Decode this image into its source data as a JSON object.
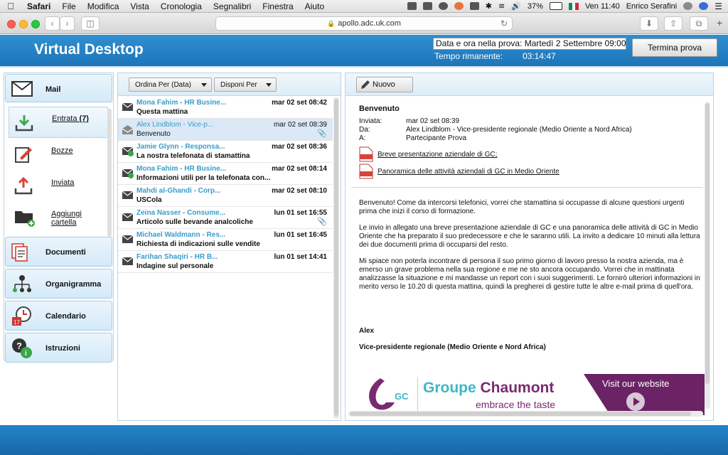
{
  "menubar": {
    "app": "Safari",
    "items": [
      "File",
      "Modifica",
      "Vista",
      "Cronologia",
      "Segnalibri",
      "Finestra",
      "Aiuto"
    ],
    "battery": "37%",
    "clock": "Ven 11:40",
    "user": "Enrico Serafini"
  },
  "browser": {
    "url": "apollo.adc.uk.com"
  },
  "header": {
    "title": "Virtual Desktop",
    "datetime": "Data e ora nella prova: Martedì 2 Settembre 09:00",
    "time_left_label": "Tempo rimanente:",
    "time_left_value": "03:14:47",
    "end_button": "Termina prova"
  },
  "nav": {
    "mail": "Mail",
    "sub": {
      "inbox": "Entrata",
      "inbox_count": "(7)",
      "drafts": "Bozze",
      "sent": "Inviata",
      "add_folder": "Aggiungi cartella"
    },
    "documents": "Documenti",
    "org": "Organigramma",
    "calendar": "Calendario",
    "instructions": "Istruzioni"
  },
  "list": {
    "sort_label": "Ordina Per (Data)",
    "arrange_label": "Disponi Per",
    "messages": [
      {
        "from": "Mona Fahim - HR Busine...",
        "date": "mar 02 set 08:42",
        "subject": "Questa mattina"
      },
      {
        "from": "Alex Lindblom - Vice-p...",
        "date": "mar 02 set 08:39",
        "subject": "Benvenuto"
      },
      {
        "from": "Jamie Glynn - Responsa...",
        "date": "mar 02 set 08:36",
        "subject": "La nostra telefonata di stamattina"
      },
      {
        "from": "Mona Fahim - HR Busine...",
        "date": "mar 02 set 08:14",
        "subject": "Informazioni utili per la telefonata con..."
      },
      {
        "from": "Mahdi al-Ghandi - Corp...",
        "date": "mar 02 set 08:10",
        "subject": "USCola"
      },
      {
        "from": "Zeina Nasser - Consume...",
        "date": "lun 01 set 16:55",
        "subject": "Articolo sulle bevande analcoliche"
      },
      {
        "from": "Michael Waldmann - Res...",
        "date": "lun 01 set 16:45",
        "subject": "Richiesta di indicazioni sulle vendite"
      },
      {
        "from": "Farihan Shaqiri - HR B...",
        "date": "lun 01 set 14:41",
        "subject": "Indagine sul personale"
      }
    ]
  },
  "reader": {
    "new_button": "Nuovo",
    "subject": "Benvenuto",
    "sent_label": "Inviata:",
    "sent_value": "mar 02 set 08:39",
    "from_label": "Da:",
    "from_value": "Alex Lindblom - Vice-presidente regionale (Medio Oriente a Nord Africa)",
    "to_label": "A:",
    "to_value": "Partecipante Prova",
    "attachments": [
      "Breve presentazione aziendale di GC;",
      "Panoramica delle attività aziendali di GC in Medio Oriente"
    ],
    "body": [
      "Benvenuto! Come da intercorsi telefonici, vorrei che stamattina si occupasse di alcune questioni urgenti prima che inizi il corso di formazione.",
      "Le invio in allegato una breve presentazione aziendale di GC e una panoramica delle attività di GC in Medio Oriente che ha preparato il suo predecessore e che le saranno utili. La invito a dedicare 10 minuti alla lettura dei due documenti prima di occuparsi del resto.",
      "Mi spiace non poterla incontrare di persona il suo primo giorno di lavoro presso la nostra azienda, ma è emerso un grave problema nella sua regione e me ne sto ancora occupando. Vorrei che in mattinata analizzasse la situazione e mi mandasse un report con i suoi suggerimenti. Le fornirò ulteriori informazioni in merito verso le 10.20 di questa mattina, quindi la pregherei di gestire tutte le altre e-mail prima di quell'ora."
    ],
    "signature_name": "Alex",
    "signature_role": "Vice-presidente regionale (Medio Oriente e Nord Africa)",
    "banner": {
      "logo_letters": "GC",
      "brand_a": "Groupe",
      "brand_b": "Chaumont",
      "tagline": "embrace the taste",
      "cta": "Visit our website"
    }
  },
  "colors": {
    "header_blue": "#1d75b8",
    "sender_teal": "#3a9cc8",
    "brand_purple": "#6b2365",
    "brand_teal": "#3fb7c4"
  }
}
